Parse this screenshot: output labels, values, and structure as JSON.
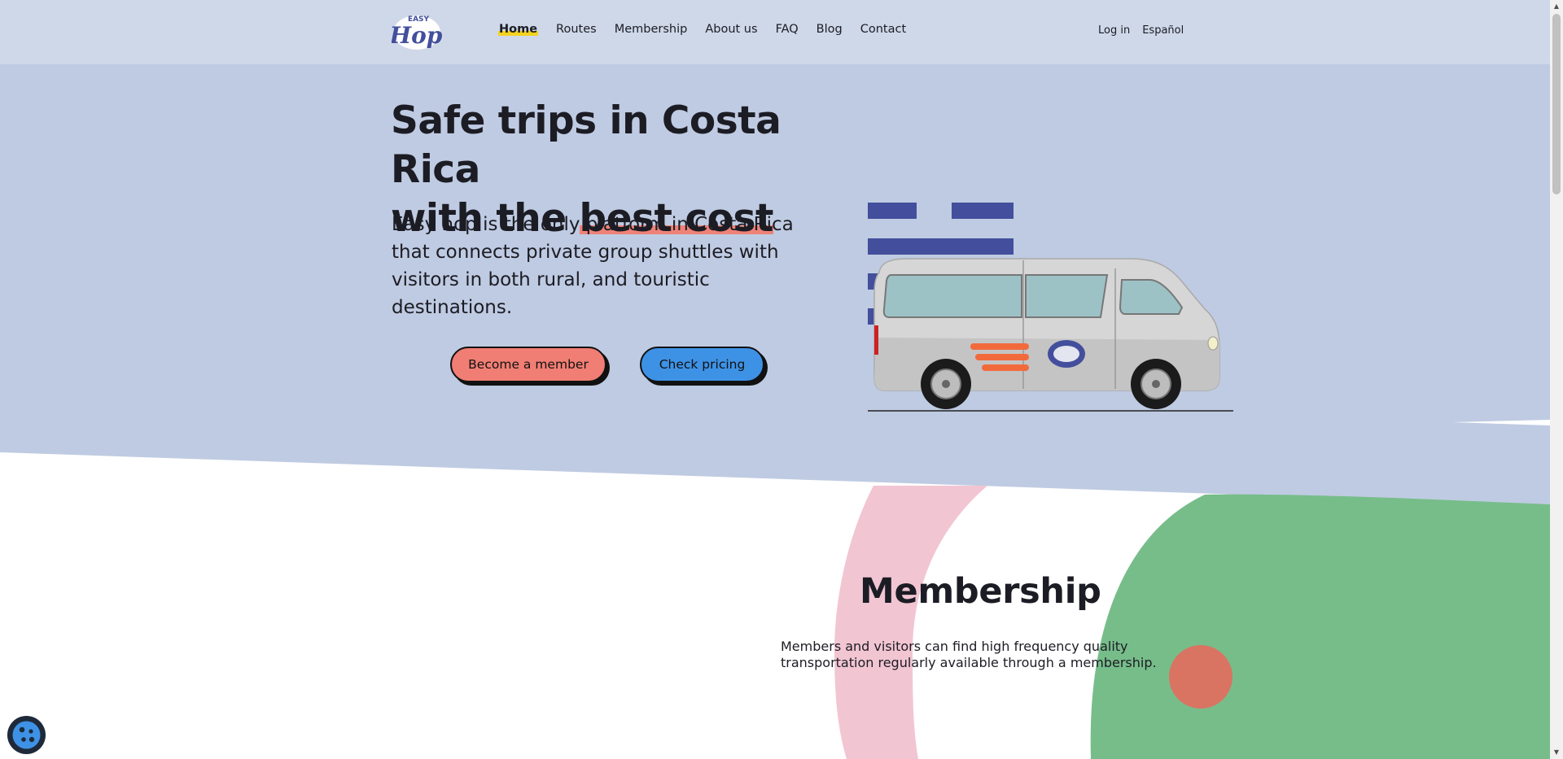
{
  "header": {
    "logo_text_top": "EASY",
    "logo_text_main": "Hop",
    "nav": [
      {
        "label": "Home",
        "active": true
      },
      {
        "label": "Routes",
        "active": false
      },
      {
        "label": "Membership",
        "active": false
      },
      {
        "label": "About us",
        "active": false
      },
      {
        "label": "FAQ",
        "active": false
      },
      {
        "label": "Blog",
        "active": false
      },
      {
        "label": "Contact",
        "active": false
      }
    ],
    "login": "Log in",
    "language": "Español"
  },
  "hero": {
    "title_line1": "Safe trips in Costa Rica",
    "title_line2_prefix": "with the ",
    "title_highlight": "best cost",
    "description": "Easy hop is the only platform in Costa Rica that connects private group shuttles with visitors in both rural, and touristic destinations.",
    "cta_primary": "Become a member",
    "cta_secondary": "Check pricing"
  },
  "membership": {
    "title": "Membership",
    "description": "Members and visitors can find high frequency quality transportation regularly available through a membership."
  },
  "colors": {
    "header_bg": "#ced8e9",
    "hero_bg": "#bfcbe2",
    "accent_salmon": "#f07e74",
    "accent_blue": "#3e92e6",
    "brand_indigo": "#434f9c",
    "highlight_yellow": "#f4d21f",
    "green_blob": "#77bd8a",
    "pink_arc": "#f2c5d2"
  },
  "icons": {
    "cookie": "cookie-settings-icon",
    "scroll_up": "triangle-up",
    "scroll_down": "triangle-down"
  }
}
